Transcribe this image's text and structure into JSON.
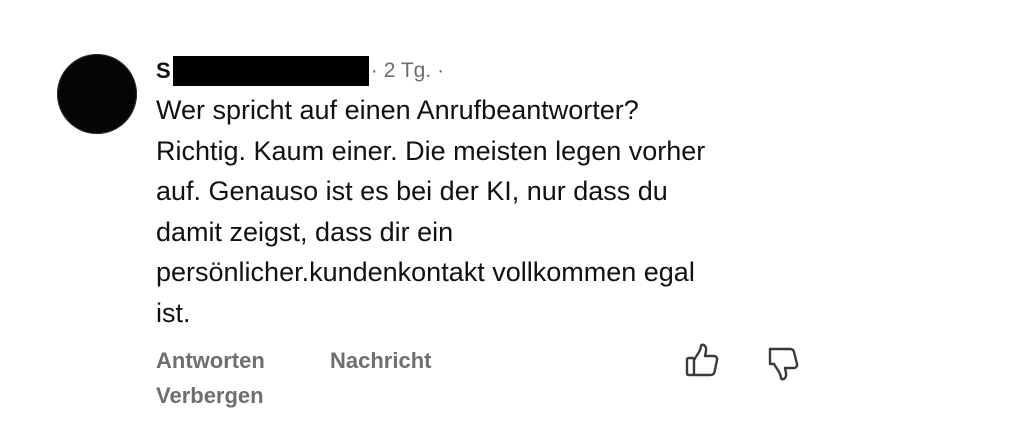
{
  "comment": {
    "author_initial": "S",
    "author_redacted": true,
    "timestamp": "2 Tg.",
    "meta_prefix": "·",
    "meta_suffix": "·",
    "text": "Wer spricht auf einen Anrufbeantworter?\nRichtig. Kaum einer. Die meisten legen vorher\nauf. Genauso ist es bei der KI, nur dass du\ndamit zeigst, dass dir ein\npersönlicher.kundenkontakt vollkommen egal\nist."
  },
  "actions": {
    "reply_label": "Antworten",
    "message_label": "Nachricht",
    "hide_label": "Verbergen"
  },
  "icons": {
    "like": "thumbs-up-icon",
    "dislike": "thumbs-down-icon"
  },
  "colors": {
    "text": "#111111",
    "meta": "#6d6d6d",
    "action": "#6f6f6f",
    "redaction": "#000000",
    "avatar": "#050505"
  }
}
